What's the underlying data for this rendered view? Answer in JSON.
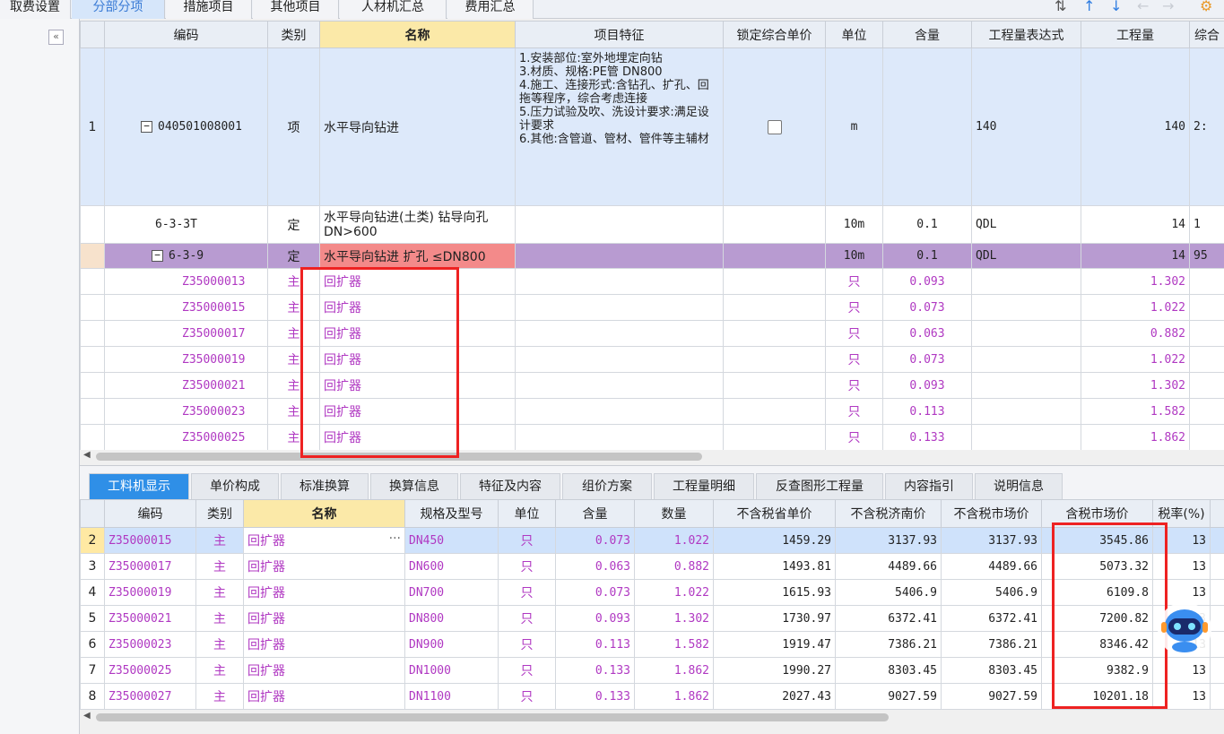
{
  "top_tabs": [
    "取费设置",
    "分部分项",
    "措施项目",
    "其他项目",
    "人材机汇总",
    "费用汇总"
  ],
  "upper": {
    "headers": [
      "编码",
      "类别",
      "名称",
      "项目特征",
      "锁定综合单价",
      "单位",
      "含量",
      "工程量表达式",
      "工程量",
      "综合"
    ],
    "row1": {
      "index": "1",
      "code": "040501008001",
      "type": "项",
      "name": "水平导向钻进",
      "feature": "1.安装部位:室外地埋定向钻\n3.材质、规格:PE管 DN800\n4.施工、连接形式:含钻孔、扩孔、回拖等程序，综合考虑连接\n5.压力试验及吹、洗设计要求:满足设计要求\n6.其他:含管道、管材、管件等主辅材",
      "unit": "m",
      "expr": "140",
      "quantity": "140",
      "comp": "2:"
    },
    "row2": {
      "code": "6-3-3T",
      "type": "定",
      "name": "水平导向钻进(土类) 钻导向孔 DN>600",
      "unit": "10m",
      "content": "0.1",
      "expr": "QDL",
      "quantity": "14",
      "comp": "1"
    },
    "row3": {
      "code": "6-3-9",
      "type": "定",
      "name": "水平导向钻进 扩孔 ≤DN800",
      "unit": "10m",
      "content": "0.1",
      "expr": "QDL",
      "quantity": "14",
      "comp": "95"
    },
    "materials": [
      {
        "code": "Z35000013",
        "type": "主",
        "name": "回扩器",
        "unit": "只",
        "content": "0.093",
        "quantity": "1.302"
      },
      {
        "code": "Z35000015",
        "type": "主",
        "name": "回扩器",
        "unit": "只",
        "content": "0.073",
        "quantity": "1.022"
      },
      {
        "code": "Z35000017",
        "type": "主",
        "name": "回扩器",
        "unit": "只",
        "content": "0.063",
        "quantity": "0.882"
      },
      {
        "code": "Z35000019",
        "type": "主",
        "name": "回扩器",
        "unit": "只",
        "content": "0.073",
        "quantity": "1.022"
      },
      {
        "code": "Z35000021",
        "type": "主",
        "name": "回扩器",
        "unit": "只",
        "content": "0.093",
        "quantity": "1.302"
      },
      {
        "code": "Z35000023",
        "type": "主",
        "name": "回扩器",
        "unit": "只",
        "content": "0.113",
        "quantity": "1.582"
      },
      {
        "code": "Z35000025",
        "type": "主",
        "name": "回扩器",
        "unit": "只",
        "content": "0.133",
        "quantity": "1.862"
      }
    ]
  },
  "lower_tabs": [
    "工料机显示",
    "单价构成",
    "标准换算",
    "换算信息",
    "特征及内容",
    "组价方案",
    "工程量明细",
    "反查图形工程量",
    "内容指引",
    "说明信息"
  ],
  "lower": {
    "headers": [
      "编码",
      "类别",
      "名称",
      "规格及型号",
      "单位",
      "含量",
      "数量",
      "不含税省单价",
      "不含税济南价",
      "不含税市场价",
      "含税市场价",
      "税率(%)"
    ],
    "rows": [
      {
        "index": "2",
        "code": "Z35000015",
        "type": "主",
        "name": "回扩器",
        "spec": "DN450",
        "unit": "只",
        "content": "0.073",
        "qty": "1.022",
        "prov": "1459.29",
        "jinan": "3137.93",
        "market": "3137.93",
        "market_tax": "3545.86",
        "tax": "13"
      },
      {
        "index": "3",
        "code": "Z35000017",
        "type": "主",
        "name": "回扩器",
        "spec": "DN600",
        "unit": "只",
        "content": "0.063",
        "qty": "0.882",
        "prov": "1493.81",
        "jinan": "4489.66",
        "market": "4489.66",
        "market_tax": "5073.32",
        "tax": "13"
      },
      {
        "index": "4",
        "code": "Z35000019",
        "type": "主",
        "name": "回扩器",
        "spec": "DN700",
        "unit": "只",
        "content": "0.073",
        "qty": "1.022",
        "prov": "1615.93",
        "jinan": "5406.9",
        "market": "5406.9",
        "market_tax": "6109.8",
        "tax": "13"
      },
      {
        "index": "5",
        "code": "Z35000021",
        "type": "主",
        "name": "回扩器",
        "spec": "DN800",
        "unit": "只",
        "content": "0.093",
        "qty": "1.302",
        "prov": "1730.97",
        "jinan": "6372.41",
        "market": "6372.41",
        "market_tax": "7200.82",
        "tax": "13"
      },
      {
        "index": "6",
        "code": "Z35000023",
        "type": "主",
        "name": "回扩器",
        "spec": "DN900",
        "unit": "只",
        "content": "0.113",
        "qty": "1.582",
        "prov": "1919.47",
        "jinan": "7386.21",
        "market": "7386.21",
        "market_tax": "8346.42",
        "tax": "13"
      },
      {
        "index": "7",
        "code": "Z35000025",
        "type": "主",
        "name": "回扩器",
        "spec": "DN1000",
        "unit": "只",
        "content": "0.133",
        "qty": "1.862",
        "prov": "1990.27",
        "jinan": "8303.45",
        "market": "8303.45",
        "market_tax": "9382.9",
        "tax": "13"
      },
      {
        "index": "8",
        "code": "Z35000027",
        "type": "主",
        "name": "回扩器",
        "spec": "DN1100",
        "unit": "只",
        "content": "0.133",
        "qty": "1.862",
        "prov": "2027.43",
        "jinan": "9027.59",
        "market": "9027.59",
        "market_tax": "10201.18",
        "tax": "13"
      }
    ]
  },
  "colors": {
    "accent": "#2f8fe7",
    "highlight_box": "#e22222",
    "material_text": "#b038c2",
    "selected_row": "#b89bd1"
  }
}
